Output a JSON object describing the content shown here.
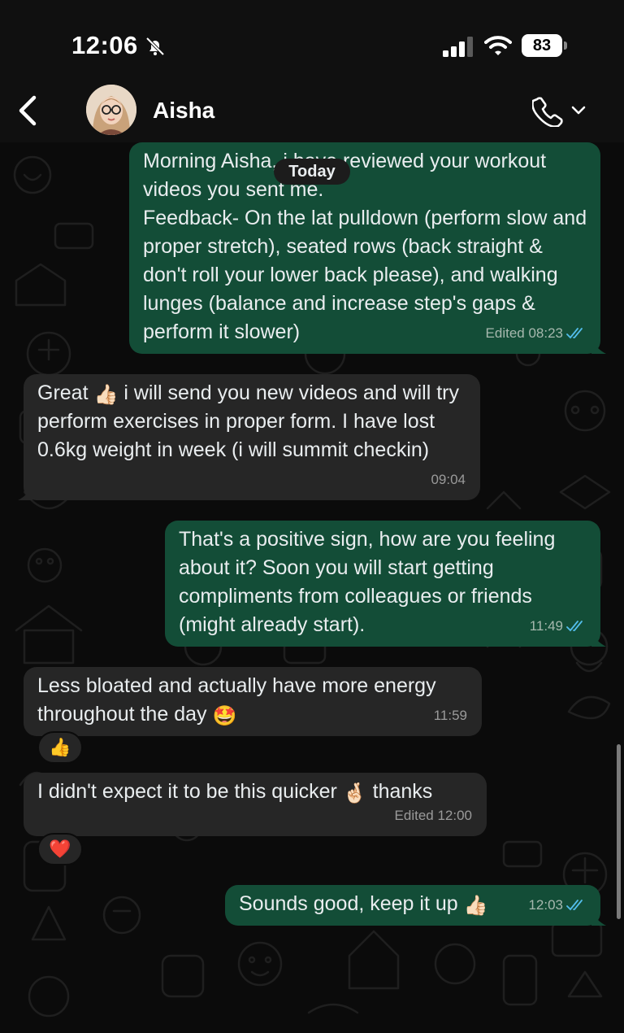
{
  "status_bar": {
    "time": "12:06",
    "battery": "83",
    "icons": [
      "bell-slash-icon",
      "cellular-signal-icon",
      "wifi-icon",
      "battery-icon"
    ]
  },
  "header": {
    "contact_name": "Aisha",
    "back_icon": "chevron-left-icon",
    "call_icon": "phone-icon",
    "call_menu_icon": "chevron-down-icon"
  },
  "date_divider": "Today",
  "messages": [
    {
      "direction": "out",
      "text": "Morning Aisha, i have reviewed your workout videos you sent me.\nFeedback- On the lat pulldown (perform slow and proper stretch), seated rows (back straight & don't roll your lower back please), and walking lunges (balance and increase step's gaps & perform it slower)",
      "meta": "Edited 08:23",
      "status": "read"
    },
    {
      "direction": "in",
      "text_a": "Great ",
      "emoji": "👍🏻",
      "text_b": " i will send you new videos and will try perform exercises in proper form. I have lost 0.6kg weight in week (i will summit checkin)",
      "meta": "09:04"
    },
    {
      "direction": "out",
      "text": "That's a positive sign, how are you feeling about it? Soon you will start getting compliments from colleagues or friends (might already start).",
      "meta": "11:49",
      "status": "read"
    },
    {
      "direction": "in",
      "text": "Less bloated and actually have more energy throughout the day ",
      "emoji": "🤩",
      "meta": "11:59",
      "reaction": "👍"
    },
    {
      "direction": "in",
      "text_a": "I didn't expect it to be this quicker ",
      "emoji": "🤞🏻",
      "text_b": " thanks",
      "meta": "Edited 12:00",
      "reaction": "❤️"
    },
    {
      "direction": "out",
      "text": "Sounds good, keep it up ",
      "emoji": "👍🏻",
      "meta": "12:03",
      "status": "read"
    }
  ],
  "colors": {
    "outgoing_bubble": "#134d37",
    "incoming_bubble": "#262626",
    "background": "#0b0b0b",
    "read_ticks": "#53bdeb"
  }
}
